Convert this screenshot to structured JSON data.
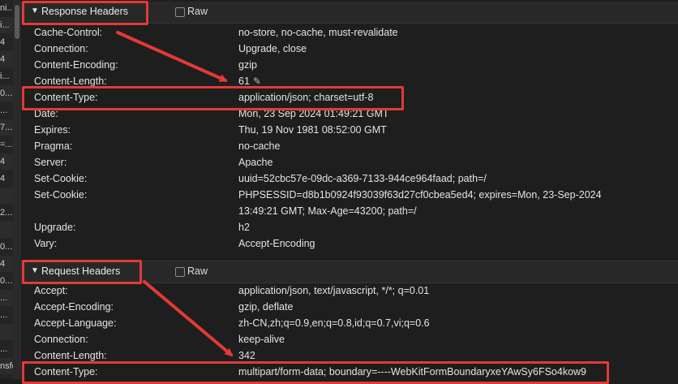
{
  "left_strip": {
    "rows": [
      "ni..",
      "i...",
      "4",
      "4",
      "i...",
      "0...",
      "...",
      "7...",
      "=...",
      "4",
      "4",
      "",
      "2...",
      "",
      "0...",
      "4",
      "0...",
      "...",
      "...",
      "",
      "...",
      "nsferr"
    ]
  },
  "response_headers": {
    "title": "Response Headers",
    "toggle": "▼",
    "raw_label": "Raw",
    "rows": [
      {
        "name": "Cache-Control:",
        "value": "no-store, no-cache, must-revalidate"
      },
      {
        "name": "Connection:",
        "value": "Upgrade, close"
      },
      {
        "name": "Content-Encoding:",
        "value": "gzip"
      },
      {
        "name": "Content-Length:",
        "value": "61"
      },
      {
        "name": "Content-Type:",
        "value": "application/json; charset=utf-8"
      },
      {
        "name": "Date:",
        "value": "Mon, 23 Sep 2024 01:49:21 GMT"
      },
      {
        "name": "Expires:",
        "value": "Thu, 19 Nov 1981 08:52:00 GMT"
      },
      {
        "name": "Pragma:",
        "value": "no-cache"
      },
      {
        "name": "Server:",
        "value": "Apache"
      },
      {
        "name": "Set-Cookie:",
        "value": "uuid=52cbc57e-09dc-a369-7133-944ce964faad; path=/"
      },
      {
        "name": "Set-Cookie:",
        "value": "PHPSESSID=d8b1b0924f93039f63d27cf0cbea5ed4; expires=Mon, 23-Sep-2024"
      },
      {
        "name": "",
        "value": "13:49:21 GMT; Max-Age=43200; path=/"
      },
      {
        "name": "Upgrade:",
        "value": "h2"
      },
      {
        "name": "Vary:",
        "value": "Accept-Encoding"
      }
    ]
  },
  "request_headers": {
    "title": "Request Headers",
    "toggle": "▼",
    "raw_label": "Raw",
    "rows": [
      {
        "name": "Accept:",
        "value": "application/json, text/javascript, */*; q=0.01"
      },
      {
        "name": "Accept-Encoding:",
        "value": "gzip, deflate"
      },
      {
        "name": "Accept-Language:",
        "value": "zh-CN,zh;q=0.9,en;q=0.8,id;q=0.7,vi;q=0.6"
      },
      {
        "name": "Connection:",
        "value": "keep-alive"
      },
      {
        "name": "Content-Length:",
        "value": "342"
      },
      {
        "name": "Content-Type:",
        "value": "multipart/form-data; boundary=----WebKitFormBoundaryxeYAwSy6FSo4kow9"
      }
    ]
  },
  "icons": {
    "edit": "pencil-icon",
    "disclosure": "disclosure-triangle-icon",
    "checkbox": "checkbox-icon"
  },
  "colors": {
    "annotation_red": "#e23a36",
    "background": "#1e1e1e",
    "section_header_bg": "#282828"
  }
}
